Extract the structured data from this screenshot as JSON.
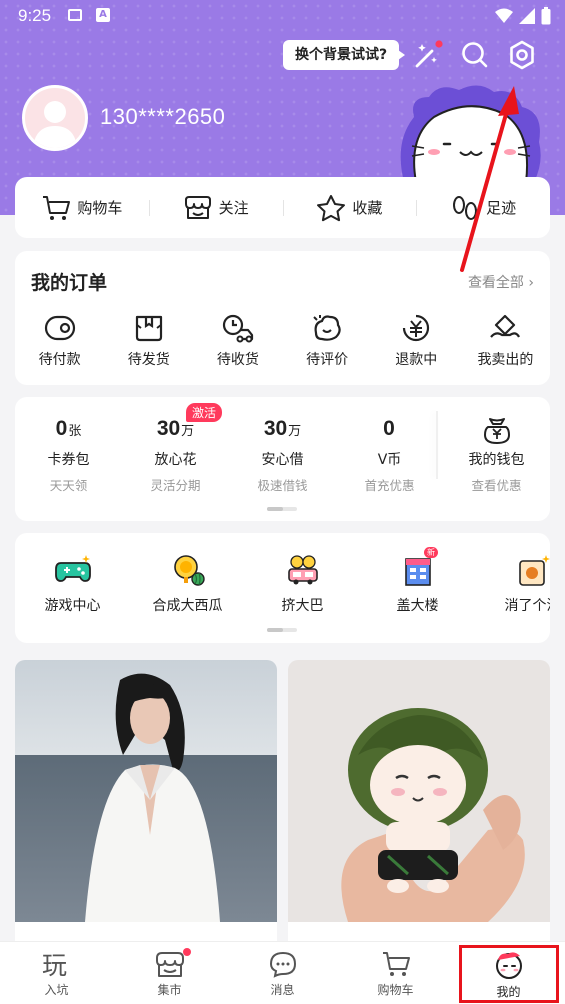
{
  "status_bar": {
    "time": "9:25"
  },
  "header": {
    "bg_tip": "换个背景试试?",
    "phone": "130****2650",
    "icons": [
      "magic-wand-icon",
      "search-icon",
      "settings-icon"
    ]
  },
  "quick_links": [
    {
      "label": "购物车",
      "icon": "cart-icon"
    },
    {
      "label": "关注",
      "icon": "shop-follow-icon"
    },
    {
      "label": "收藏",
      "icon": "star-icon"
    },
    {
      "label": "足迹",
      "icon": "footprint-icon"
    }
  ],
  "orders": {
    "title": "我的订单",
    "view_all": "查看全部",
    "items": [
      {
        "label": "待付款",
        "icon": "wallet-pay-icon"
      },
      {
        "label": "待发货",
        "icon": "package-icon"
      },
      {
        "label": "待收货",
        "icon": "delivery-truck-icon"
      },
      {
        "label": "待评价",
        "icon": "review-icon"
      },
      {
        "label": "退款中",
        "icon": "refund-icon"
      },
      {
        "label": "我卖出的",
        "icon": "sold-icon"
      }
    ]
  },
  "wallet": {
    "badge": "激活",
    "items": [
      {
        "num": "0",
        "unit": "张",
        "label": "卡券包",
        "sub": "天天领"
      },
      {
        "num": "30",
        "unit": "万",
        "label": "放心花",
        "sub": "灵活分期"
      },
      {
        "num": "30",
        "unit": "万",
        "label": "安心借",
        "sub": "极速借钱"
      },
      {
        "num": "0",
        "unit": "",
        "label": "V币",
        "sub": "首充优惠"
      }
    ],
    "my_wallet": {
      "label": "我的钱包",
      "sub": "查看优惠"
    }
  },
  "games": [
    {
      "label": "游戏中心",
      "icon": "gamepad-icon"
    },
    {
      "label": "合成大西瓜",
      "icon": "watermelon-icon"
    },
    {
      "label": "挤大巴",
      "icon": "bus-icon"
    },
    {
      "label": "盖大楼",
      "icon": "building-icon"
    },
    {
      "label": "消了个消",
      "icon": "tile-match-icon"
    }
  ],
  "games_new_badge": "新",
  "tabs": [
    {
      "label": "入坑",
      "icon": "play-icon"
    },
    {
      "label": "集市",
      "icon": "market-icon"
    },
    {
      "label": "消息",
      "icon": "message-icon"
    },
    {
      "label": "购物车",
      "icon": "cart-icon"
    },
    {
      "label": "我的",
      "icon": "profile-mascot-icon"
    }
  ],
  "colors": {
    "header": "#9a7ae6",
    "accent": "#ff3a5c",
    "highlight": "#e8141c"
  }
}
